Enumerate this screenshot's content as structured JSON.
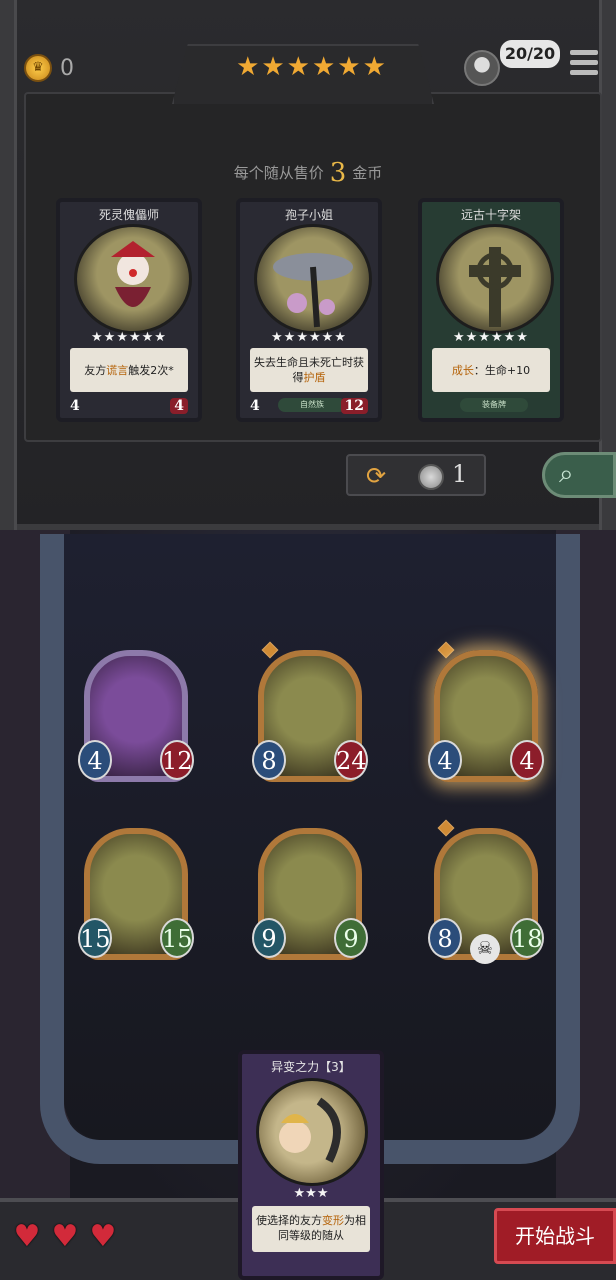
{
  "header": {
    "gold": "0",
    "tier_stars": "★★★★★★",
    "turn_count": "20/20"
  },
  "shop": {
    "price_prefix": "每个随从售价",
    "price_value": "3",
    "price_suffix": "金币",
    "cards": [
      {
        "name": "死灵傀儡师",
        "stars": "★★★★★★",
        "desc_prefix": "友方",
        "desc_hl": "谎言",
        "desc_suffix": "触发2次*",
        "attack": "4",
        "health": "4",
        "tag": ""
      },
      {
        "name": "孢子小姐",
        "stars": "★★★★★★",
        "desc_prefix": "失去生命且未死亡时获得",
        "desc_hl": "护盾",
        "desc_suffix": "",
        "attack": "4",
        "health": "12",
        "tag": "自然族"
      },
      {
        "name": "远古十字架",
        "stars": "★★★★★★",
        "desc_prefix": "",
        "desc_hl": "成长",
        "desc_suffix": "：生命+10",
        "attack": "",
        "health": "",
        "tag": "装备牌"
      }
    ],
    "reroll_cost": "1"
  },
  "board": {
    "minions": [
      {
        "attack": "4",
        "health": "12"
      },
      {
        "attack": "8",
        "health": "24"
      },
      {
        "attack": "4",
        "health": "4"
      },
      {
        "attack": "15",
        "health": "15"
      },
      {
        "attack": "9",
        "health": "9"
      },
      {
        "attack": "8",
        "health": "18"
      }
    ]
  },
  "hand": {
    "title": "异变之力【3】",
    "stars": "★★★",
    "desc_prefix": "使选择的友方",
    "desc_hl": "变形",
    "desc_suffix": "为相同等级的随从"
  },
  "lives": {
    "hearts": [
      "♥",
      "♥",
      "♥"
    ]
  },
  "actions": {
    "start_battle": "开始战斗"
  },
  "colors": {
    "gold": "#f0a933",
    "health_red": "#8c1d2a",
    "attack_blue": "#2b4d7a",
    "start_button": "#a01c26"
  }
}
